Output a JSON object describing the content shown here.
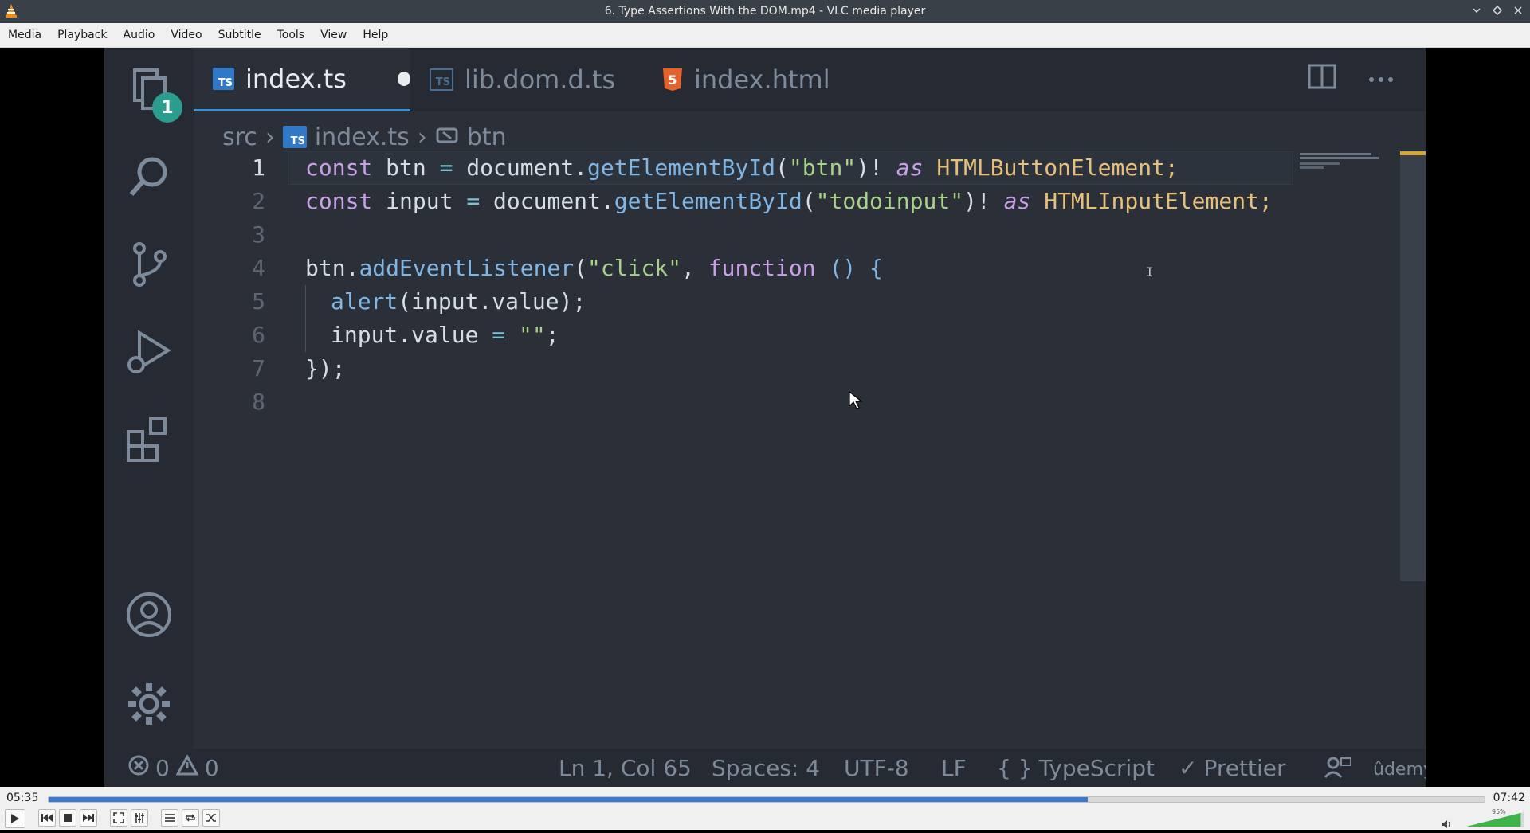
{
  "window": {
    "title": "6. Type Assertions With the DOM.mp4 - VLC media player"
  },
  "menu": [
    "Media",
    "Playback",
    "Audio",
    "Video",
    "Subtitle",
    "Tools",
    "View",
    "Help"
  ],
  "video": {
    "activity_bar": {
      "explorer_badge": "1"
    },
    "tabs": [
      {
        "label": "index.ts",
        "icon": "TS",
        "active": true
      },
      {
        "label": "lib.dom.d.ts",
        "icon": "TS",
        "active": false
      },
      {
        "label": "index.html",
        "icon": "5",
        "active": false
      }
    ],
    "breadcrumb": {
      "folder": "src",
      "file": "index.ts",
      "symbol": "btn"
    },
    "code_lines": [
      {
        "num": "1"
      },
      {
        "num": "2"
      },
      {
        "num": "3"
      },
      {
        "num": "4"
      },
      {
        "num": "5"
      },
      {
        "num": "6"
      },
      {
        "num": "7"
      },
      {
        "num": "8"
      }
    ],
    "code": {
      "l1": {
        "const": "const",
        "name": " btn ",
        "eq": "=",
        "obj": " document.",
        "fn": "getElementById",
        "open": "(",
        "str": "\"btn\"",
        "close": ")! ",
        "as": "as",
        "type": " HTMLButtonElement;"
      },
      "l2": {
        "const": "const",
        "name": " input ",
        "eq": "=",
        "obj": " document.",
        "fn": "getElementById",
        "open": "(",
        "str": "\"todoinput\"",
        "close": ")! ",
        "as": "as",
        "type": " HTMLInputElement;"
      },
      "l4": {
        "obj": "btn.",
        "fn": "addEventListener",
        "open": "(",
        "str": "\"click\"",
        "comma": ", ",
        "kw": "function",
        "rest": " () {"
      },
      "l5": {
        "fn": "alert",
        "rest": "(input.value);"
      },
      "l6": {
        "rest": "input.value ",
        "eq": "=",
        "str": " \"\"",
        "end": ";"
      },
      "l7": {
        "rest": "});"
      }
    },
    "status": {
      "errors": "0",
      "warnings": "0",
      "position": "Ln 1, Col 65",
      "spaces": "Spaces: 4",
      "encoding": "UTF-8",
      "eol": "LF",
      "language": "TypeScript",
      "formatter": "Prettier",
      "watermark": "ûdemy"
    }
  },
  "player": {
    "elapsed": "05:35",
    "total": "07:42",
    "progress": 0.7235,
    "volume_percent": "95%",
    "volume_level": 0.95
  }
}
